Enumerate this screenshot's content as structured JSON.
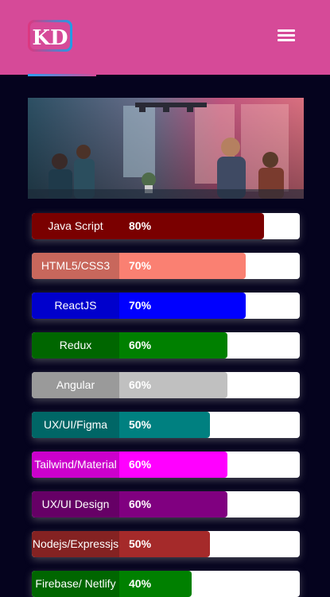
{
  "header": {
    "logo_text": "KD",
    "menu_icon": "hamburger-menu-icon",
    "background": "#d64a98"
  },
  "hero": {
    "description": "team-working-in-office-photo"
  },
  "skills": [
    {
      "name": "Java Script",
      "percent": "80%",
      "level": 0.8,
      "color": "#7a0000",
      "label_color": "#7a0000"
    },
    {
      "name": "HTML5/CSS3",
      "percent": "70%",
      "level": 0.7,
      "color": "#fa8072",
      "label_color": "#c8675c"
    },
    {
      "name": "ReactJS",
      "percent": "70%",
      "level": 0.7,
      "color": "#0000ff",
      "label_color": "#0000cc"
    },
    {
      "name": "Redux",
      "percent": "60%",
      "level": 0.6,
      "color": "#008000",
      "label_color": "#006600"
    },
    {
      "name": "Angular",
      "percent": "60%",
      "level": 0.6,
      "color": "#c0c0c0",
      "label_color": "#9a9a9a"
    },
    {
      "name": "UX/UI/Figma",
      "percent": "50%",
      "level": 0.5,
      "color": "#008080",
      "label_color": "#006666"
    },
    {
      "name": "Tailwind/Material",
      "percent": "60%",
      "level": 0.6,
      "color": "#ff00ff",
      "label_color": "#cc00cc"
    },
    {
      "name": "UX/UI Design",
      "percent": "60%",
      "level": 0.6,
      "color": "#800080",
      "label_color": "#660066"
    },
    {
      "name": "Nodejs/Expressjs",
      "percent": "50%",
      "level": 0.5,
      "color": "#a52a2a",
      "label_color": "#842222"
    },
    {
      "name": "Firebase/ Netlify",
      "percent": "40%",
      "level": 0.4,
      "color": "#008000",
      "label_color": "#006600"
    }
  ]
}
